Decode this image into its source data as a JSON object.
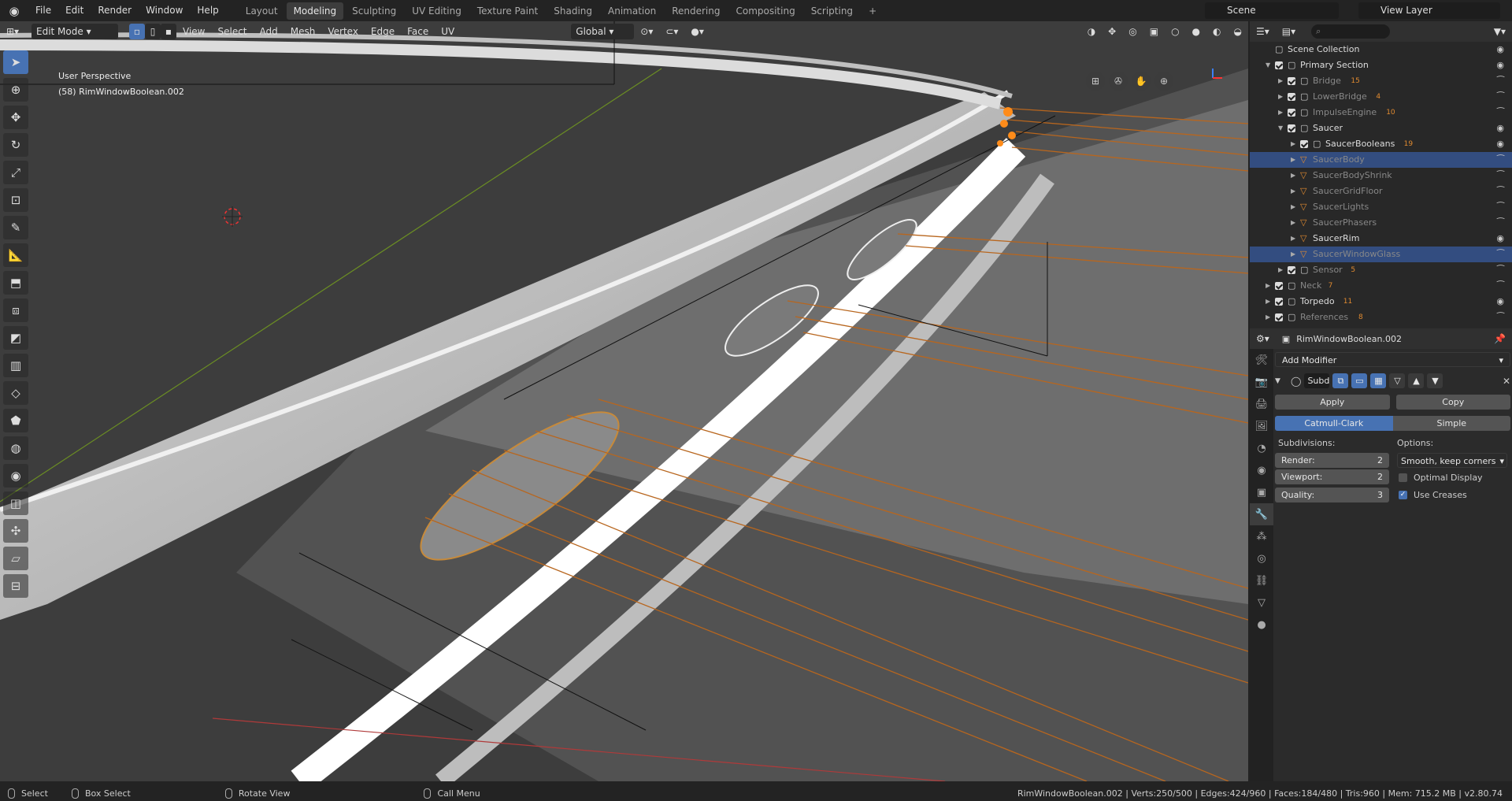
{
  "topbar": {
    "menus": [
      "File",
      "Edit",
      "Render",
      "Window",
      "Help"
    ],
    "workspaces": [
      "Layout",
      "Modeling",
      "Sculpting",
      "UV Editing",
      "Texture Paint",
      "Shading",
      "Animation",
      "Rendering",
      "Compositing",
      "Scripting"
    ],
    "active_workspace": "Modeling",
    "scene": "Scene",
    "view_layer": "View Layer",
    "add_tab": "+"
  },
  "viewport": {
    "mode": "Edit Mode",
    "menus": [
      "View",
      "Select",
      "Add",
      "Mesh",
      "Vertex",
      "Edge",
      "Face",
      "UV"
    ],
    "orientation": "Global",
    "perspective": "User Perspective",
    "object_label": "(58) RimWindowBoolean.002"
  },
  "outliner": {
    "search_placeholder": "",
    "rows": [
      {
        "label": "Scene Collection",
        "sel": false,
        "dim": false,
        "badge": ""
      },
      {
        "label": "Primary Section",
        "sel": false,
        "dim": false,
        "badge": ""
      },
      {
        "label": "Bridge",
        "sel": false,
        "dim": true,
        "badge": "15"
      },
      {
        "label": "LowerBridge",
        "sel": false,
        "dim": true,
        "badge": "4"
      },
      {
        "label": "ImpulseEngine",
        "sel": false,
        "dim": true,
        "badge": "10"
      },
      {
        "label": "Saucer",
        "sel": false,
        "dim": false,
        "badge": ""
      },
      {
        "label": "SaucerBooleans",
        "sel": false,
        "dim": false,
        "badge": "19"
      },
      {
        "label": "SaucerBody",
        "sel": true,
        "dim": true,
        "badge": ""
      },
      {
        "label": "SaucerBodyShrink",
        "sel": false,
        "dim": true,
        "badge": ""
      },
      {
        "label": "SaucerGridFloor",
        "sel": false,
        "dim": true,
        "badge": ""
      },
      {
        "label": "SaucerLights",
        "sel": false,
        "dim": true,
        "badge": ""
      },
      {
        "label": "SaucerPhasers",
        "sel": false,
        "dim": true,
        "badge": ""
      },
      {
        "label": "SaucerRim",
        "sel": false,
        "dim": false,
        "badge": ""
      },
      {
        "label": "SaucerWindowGlass",
        "sel": true,
        "dim": true,
        "badge": ""
      },
      {
        "label": "Sensor",
        "sel": false,
        "dim": true,
        "badge": "5"
      },
      {
        "label": "Neck",
        "sel": false,
        "dim": true,
        "badge": "7"
      },
      {
        "label": "Torpedo",
        "sel": false,
        "dim": false,
        "badge": "11"
      },
      {
        "label": "References",
        "sel": false,
        "dim": true,
        "badge": "8"
      }
    ]
  },
  "properties": {
    "object_name": "RimWindowBoolean.002",
    "add_modifier": "Add Modifier",
    "modifier_name": "Subd",
    "apply": "Apply",
    "copy": "Copy",
    "catmull": "Catmull-Clark",
    "simple": "Simple",
    "subdivisions_label": "Subdivisions:",
    "options_label": "Options:",
    "render_label": "Render:",
    "render_val": "2",
    "viewport_label": "Viewport:",
    "viewport_val": "2",
    "quality_label": "Quality:",
    "quality_val": "3",
    "uv_smooth": "Smooth, keep corners",
    "optimal_display": "Optimal Display",
    "use_creases": "Use Creases"
  },
  "status": {
    "select": "Select",
    "box_select": "Box Select",
    "rotate": "Rotate View",
    "call_menu": "Call Menu",
    "stats": "RimWindowBoolean.002 | Verts:250/500 | Edges:424/960 | Faces:184/480 | Tris:960 | Mem: 715.2 MB | v2.80.74"
  },
  "colors": {
    "accent": "#4772b3",
    "selection_orange": "#e07b10",
    "wire": "#b8661e"
  }
}
